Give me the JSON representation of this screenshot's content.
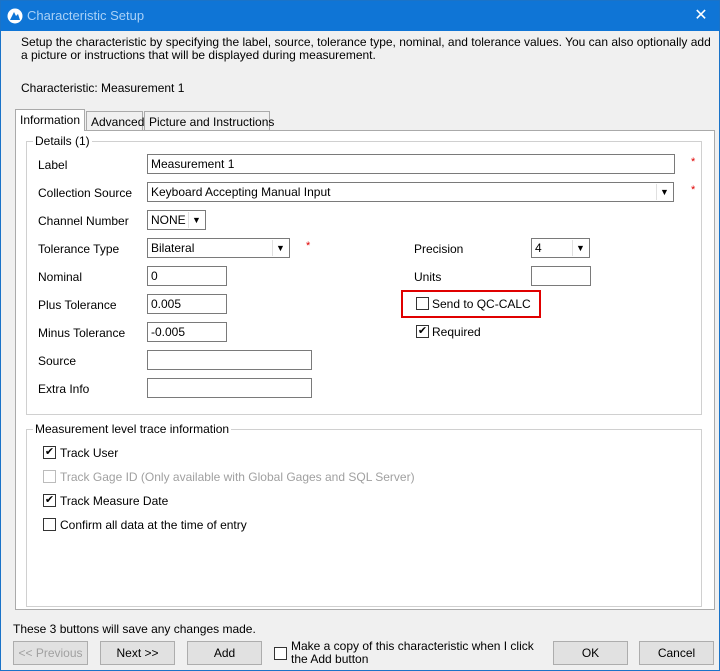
{
  "window": {
    "title": "Characteristic Setup",
    "close_glyph": "✕"
  },
  "intro_text": "Setup the characteristic by specifying the label, source, tolerance type, nominal, and tolerance values. You can also optionally add a picture or instructions that will be displayed during measurement.",
  "characteristic_label": "Characteristic: Measurement 1",
  "tabs": [
    {
      "label": "Information",
      "active": true
    },
    {
      "label": "Advanced",
      "active": false
    },
    {
      "label": "Picture and Instructions",
      "active": false
    }
  ],
  "details": {
    "title": "Details (1)",
    "label": {
      "caption": "Label",
      "value": "Measurement 1"
    },
    "collection_source": {
      "caption": "Collection Source",
      "value": "Keyboard Accepting Manual Input"
    },
    "channel_number": {
      "caption": "Channel Number",
      "value": "NONE"
    },
    "tolerance_type": {
      "caption": "Tolerance Type",
      "value": "Bilateral"
    },
    "nominal": {
      "caption": "Nominal",
      "value": "0"
    },
    "plus_tolerance": {
      "caption": "Plus Tolerance",
      "value": "0.005"
    },
    "minus_tolerance": {
      "caption": "Minus Tolerance",
      "value": "-0.005"
    },
    "source": {
      "caption": "Source",
      "value": ""
    },
    "extra_info": {
      "caption": "Extra Info",
      "value": ""
    },
    "precision": {
      "caption": "Precision",
      "value": "4"
    },
    "units": {
      "caption": "Units",
      "value": ""
    },
    "send_to_qc_calc": {
      "caption": "Send to QC-CALC",
      "checked": false
    },
    "required": {
      "caption": "Required",
      "checked": true
    },
    "required_marker": "*"
  },
  "trace": {
    "title": "Measurement level trace information",
    "track_user": {
      "caption": "Track User",
      "checked": true
    },
    "track_gage": {
      "caption": "Track Gage ID (Only available with Global Gages and SQL Server)",
      "checked": false,
      "enabled": false
    },
    "track_date": {
      "caption": "Track Measure Date",
      "checked": true
    },
    "confirm": {
      "caption": "Confirm all data at the time of entry",
      "checked": false
    }
  },
  "footer": {
    "note": "These 3 buttons will save any changes made.",
    "previous": "<< Previous",
    "next": "Next >>",
    "add": "Add",
    "copy_label": "Make a copy of this characteristic when I click the Add button",
    "ok": "OK",
    "cancel": "Cancel"
  },
  "colors": {
    "titlebar": "#0f75d6",
    "required": "#e00000",
    "highlight": "#e00000"
  },
  "glyphs": {
    "check": "✔",
    "dropdown": "▼"
  }
}
